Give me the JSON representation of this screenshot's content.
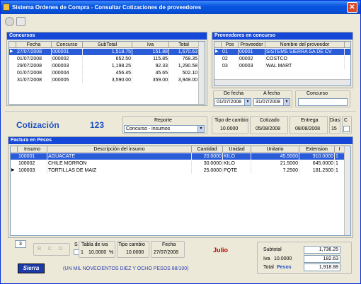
{
  "window": {
    "title": "Sistema Ordenes de Compra - Consultar Cotizaciones de proveedores",
    "close_glyph": "✕"
  },
  "concursos": {
    "title": "Concursos",
    "columns": [
      "Fecha",
      "Concurso",
      "SubTotal",
      "Iva",
      "Total"
    ],
    "rows": [
      {
        "fecha": "27/07/2008",
        "concurso": "000001",
        "subtotal": "1,518.75",
        "iva": "151.88",
        "total": "1,670.63",
        "selected": true
      },
      {
        "fecha": "01/07/2008",
        "concurso": "000002",
        "subtotal": "652.50",
        "iva": "115.85",
        "total": "768.35"
      },
      {
        "fecha": "29/07/2008",
        "concurso": "000003",
        "subtotal": "1,198.25",
        "iva": "92.33",
        "total": "1,290.58"
      },
      {
        "fecha": "01/07/2008",
        "concurso": "000004",
        "subtotal": "456.45",
        "iva": "45.65",
        "total": "502.10"
      },
      {
        "fecha": "31/07/2008",
        "concurso": "000005",
        "subtotal": "3,590.00",
        "iva": "359.00",
        "total": "3,949.00"
      }
    ]
  },
  "proveedores": {
    "title": "Proveedores en concurso",
    "columns": [
      "Pos",
      "Proveedor",
      "Nombre del proveedor"
    ],
    "rows": [
      {
        "pos": "01",
        "proveedor": "00001",
        "nombre": "SISTEMS SIERRA SA DE CV",
        "selected": true
      },
      {
        "pos": "02",
        "proveedor": "00002",
        "nombre": "COSTCO"
      },
      {
        "pos": "03",
        "proveedor": "00003",
        "nombre": "WAL MART"
      }
    ]
  },
  "filters": {
    "de_fecha_label": "De fecha",
    "de_fecha": "01/07/2008",
    "a_fecha_label": "A fecha",
    "a_fecha": "31/07/2008",
    "concurso_label": "Concurso",
    "concurso": ""
  },
  "cotizacion": {
    "label": "Cotización",
    "number": "123",
    "reporte_label": "Reporte",
    "reporte": "Concurso - insumos",
    "tipo_cambio_label": "Tipo de cambio",
    "tipo_cambio": "10.0000",
    "cotizado_label": "Cotizado",
    "cotizado": "05/08/2008",
    "entrega_label": "Entrega",
    "entrega": "08/08/2008",
    "dias_label": "Dias",
    "dias": "15",
    "c_label": "C"
  },
  "factura": {
    "title": "Factura en Pesos",
    "columns": [
      "Insumo",
      "Descripción del insumo",
      "Cantidad",
      "Unidad",
      "Unitario",
      "Extension",
      "I"
    ],
    "rows": [
      {
        "insumo": "100001",
        "descripcion": "AGUACATE",
        "cantidad": "20.0000",
        "unidad": "KILO",
        "unitario": "45.5000",
        "extension": "910.0000",
        "i": "1",
        "selected": true
      },
      {
        "insumo": "100002",
        "descripcion": "CHILE MORRON",
        "cantidad": "30.0000",
        "unidad": "KILO",
        "unitario": "21.5000",
        "extension": "645.0000",
        "i": "1"
      },
      {
        "insumo": "100003",
        "descripcion": "TORTILLAS DE MAIZ",
        "cantidad": "25.0000",
        "unidad": "PQTE",
        "unitario": "7.2500",
        "extension": "181.2500",
        "i": "1"
      }
    ]
  },
  "footer": {
    "count": "3",
    "radio_r": "R",
    "radio_c": "C",
    "radio_d": "D",
    "s_label": "S",
    "tabla_iva_label": "Tabla de iva",
    "tabla_iva_num": "1",
    "tabla_iva": "10.0000",
    "pct": "%",
    "tipo_cambio_label": "Tipo cambio",
    "tipo_cambio": "10.0000",
    "fecha_label": "Fecha",
    "fecha": "27/07/2008",
    "mes": "Julio",
    "importe_letra": "(UN MIL NOVECIENTOS DIEZ Y OCHO PESOS 88/100)",
    "logo": "Sierra"
  },
  "totals": {
    "subtotal_label": "Subtotal",
    "subtotal": "1,736.25",
    "iva_label": "Iva",
    "iva_rate": "10.0000",
    "iva": "182.63",
    "total_label": "Total",
    "moneda": "Pesos",
    "total": "1,918.88"
  },
  "colors": {
    "titlebar": "#0a55e0",
    "header": "#1648d8",
    "selection": "#2a5cd8",
    "accent": "#2050c0",
    "month": "#c00000"
  }
}
